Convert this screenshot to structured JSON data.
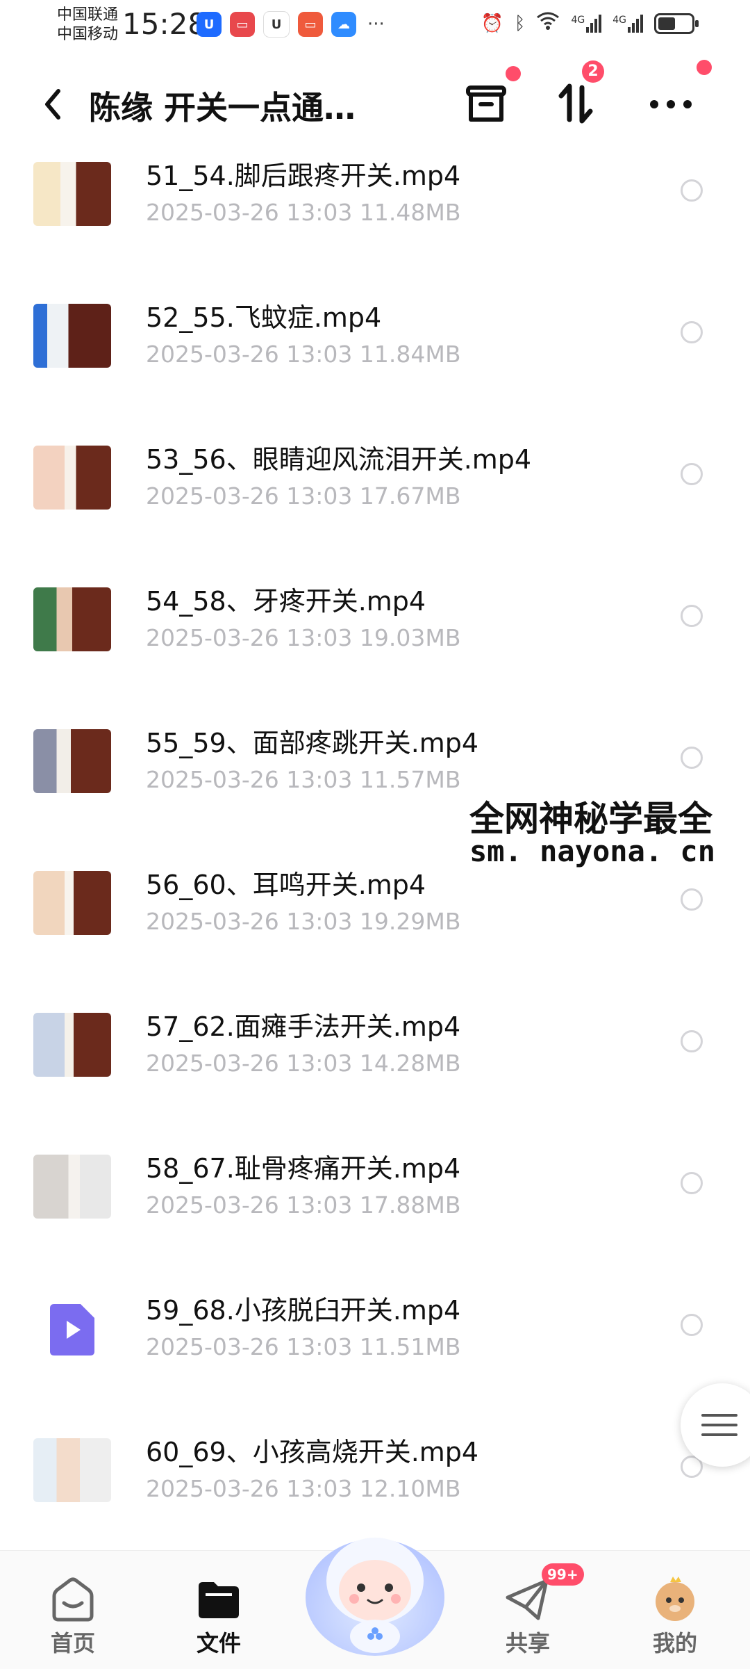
{
  "status_bar": {
    "carrier_1": "中国联通",
    "carrier_2": "中国移动",
    "time": "15:28",
    "dots": "···",
    "signal_1": "4G",
    "signal_2": "4G"
  },
  "header": {
    "title": "陈缘 开关一点通…",
    "sort_badge": "2"
  },
  "files": [
    {
      "name": "51_54.脚后跟疼开关.mp4",
      "date": "2025-03-26",
      "time": "13:03",
      "size": "11.48MB"
    },
    {
      "name": "52_55.飞蚊症.mp4",
      "date": "2025-03-26",
      "time": "13:03",
      "size": "11.84MB"
    },
    {
      "name": "53_56、眼睛迎风流泪开关.mp4",
      "date": "2025-03-26",
      "time": "13:03",
      "size": "17.67MB"
    },
    {
      "name": "54_58、牙疼开关.mp4",
      "date": "2025-03-26",
      "time": "13:03",
      "size": "19.03MB"
    },
    {
      "name": "55_59、面部疼跳开关.mp4",
      "date": "2025-03-26",
      "time": "13:03",
      "size": "11.57MB"
    },
    {
      "name": "56_60、耳鸣开关.mp4",
      "date": "2025-03-26",
      "time": "13:03",
      "size": "19.29MB"
    },
    {
      "name": "57_62.面瘫手法开关.mp4",
      "date": "2025-03-26",
      "time": "13:03",
      "size": "14.28MB"
    },
    {
      "name": "58_67.耻骨疼痛开关.mp4",
      "date": "2025-03-26",
      "time": "13:03",
      "size": "17.88MB"
    },
    {
      "name": "59_68.小孩脱臼开关.mp4",
      "date": "2025-03-26",
      "time": "13:03",
      "size": "11.51MB"
    },
    {
      "name": "60_69、小孩高烧开关.mp4",
      "date": "2025-03-26",
      "time": "13:03",
      "size": "12.10MB"
    }
  ],
  "watermark": {
    "line1": "全网神秘学最全",
    "line2": "sm. nayona. cn"
  },
  "bottom_nav": {
    "home": "首页",
    "files": "文件",
    "share": "共享",
    "share_badge": "99+",
    "mine": "我的"
  },
  "colors": {
    "accent_red": "#ff4d6a",
    "meta_gray": "#b8b8bc",
    "video_icon": "#7b6cf0"
  }
}
